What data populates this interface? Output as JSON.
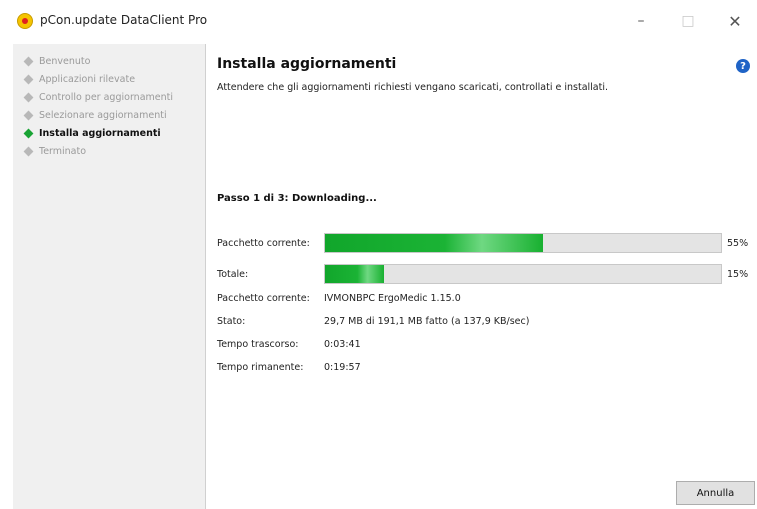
{
  "window": {
    "title": "pCon.update DataClient Pro",
    "min_label": "–",
    "max_label": "□",
    "close_label": "✕"
  },
  "steps": [
    {
      "label": "Benvenuto",
      "state": "done"
    },
    {
      "label": "Applicazioni rilevate",
      "state": "done"
    },
    {
      "label": "Controllo per aggiornamenti",
      "state": "done"
    },
    {
      "label": "Selezionare aggiornamenti",
      "state": "done"
    },
    {
      "label": "Installa aggiornamenti",
      "state": "active"
    },
    {
      "label": "Terminato",
      "state": "pending"
    }
  ],
  "main": {
    "heading": "Installa aggiornamenti",
    "help_label": "?",
    "subtitle": "Attendere che gli aggiornamenti richiesti vengano scaricati, controllati e installati.",
    "step_status": "Passo 1 di 3: Downloading..."
  },
  "progress": {
    "current_label": "Pacchetto corrente:",
    "current_fraction": 0.55,
    "current_pct": "55%",
    "total_label": "Totale:",
    "total_fraction": 0.15,
    "total_pct": "15%"
  },
  "info": [
    {
      "label": "Pacchetto corrente:",
      "value": "IVMONBPC ErgoMedic 1.15.0"
    },
    {
      "label": "Stato:",
      "value": "29,7 MB di 191,1 MB fatto (a 137,9 KB/sec)"
    },
    {
      "label": "Tempo trascorso:",
      "value": "0:03:41"
    },
    {
      "label": "Tempo rimanente:",
      "value": "0:19:57"
    }
  ],
  "buttons": {
    "cancel": "Annulla"
  },
  "colors": {
    "progress_fill": "#1bb335",
    "active_bullet": "#19a334",
    "help_icon": "#1f63c6"
  }
}
